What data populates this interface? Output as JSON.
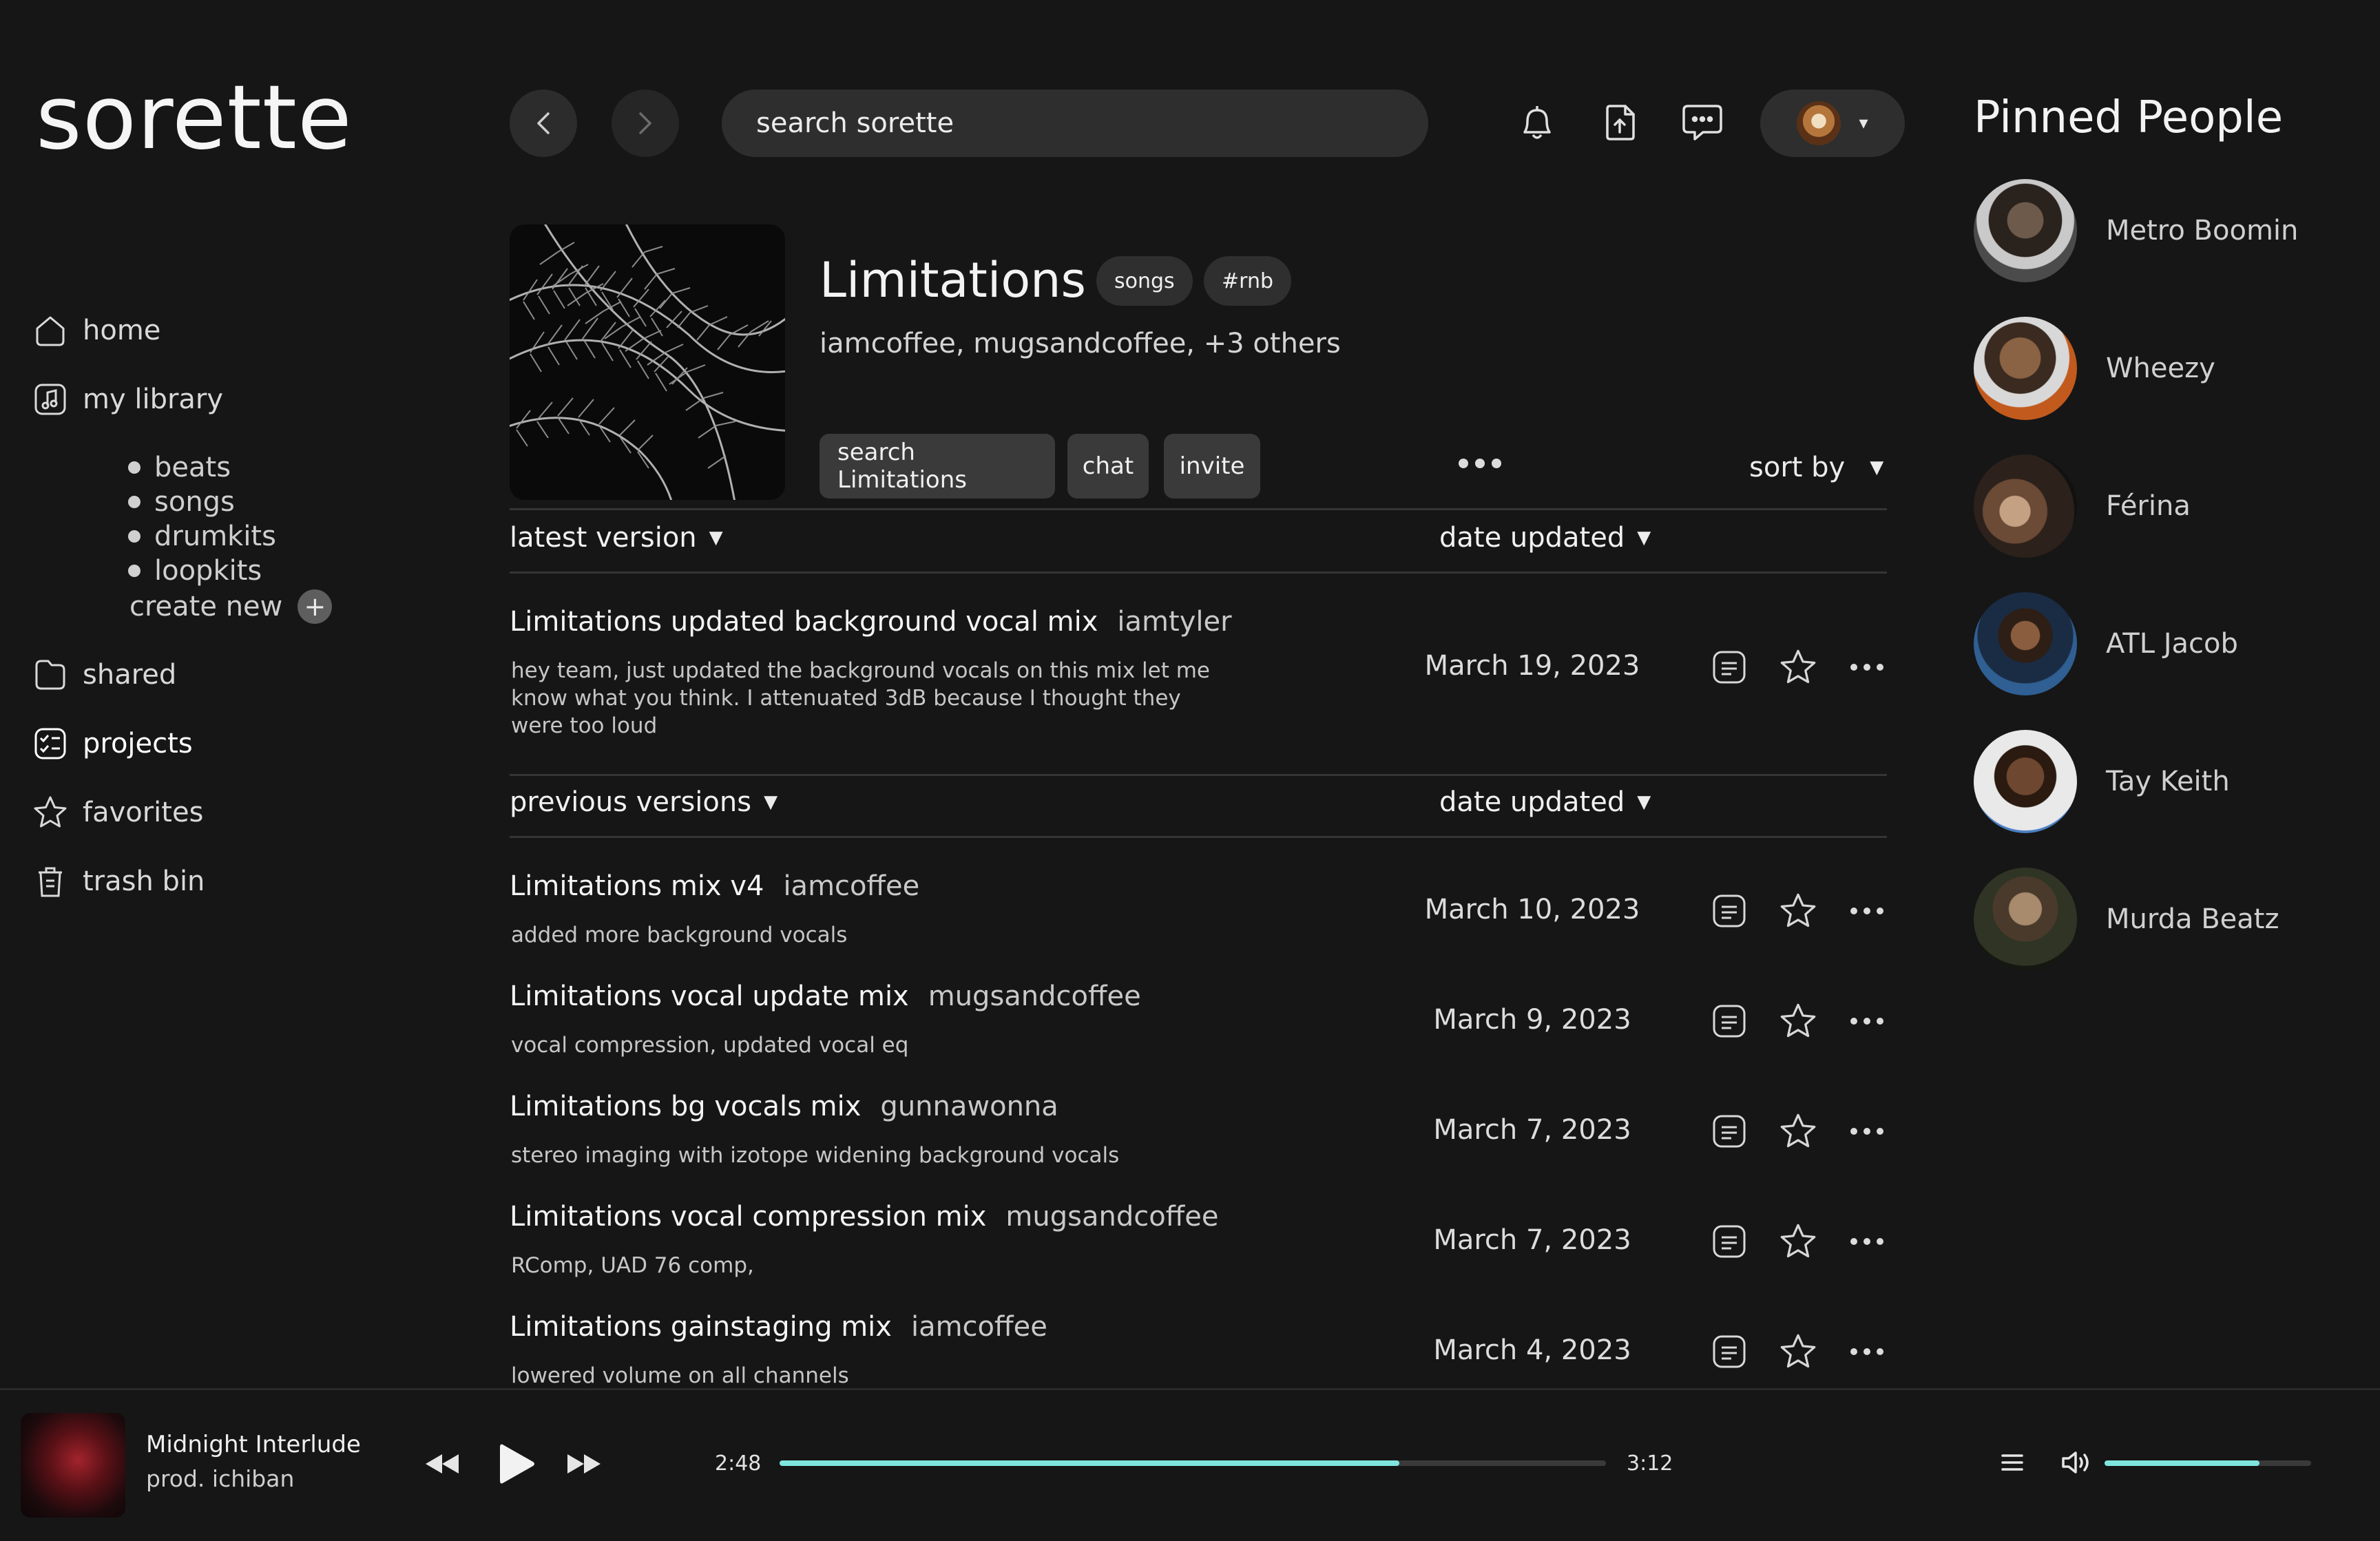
{
  "app": {
    "logo": "sorette"
  },
  "sidebar": {
    "items": [
      {
        "label": "home",
        "icon": "home-icon"
      },
      {
        "label": "my library",
        "icon": "music-note-icon"
      },
      {
        "label": "shared",
        "icon": "folder-icon"
      },
      {
        "label": "projects",
        "icon": "checklist-icon"
      },
      {
        "label": "favorites",
        "icon": "star-icon"
      },
      {
        "label": "trash bin",
        "icon": "trash-icon"
      }
    ],
    "library_sub": [
      "beats",
      "songs",
      "drumkits",
      "loopkits"
    ],
    "create_new": "create new",
    "plus_glyph": "+"
  },
  "topbar": {
    "search_placeholder": "search sorette",
    "icons": [
      "back-icon",
      "forward-icon",
      "bell-icon",
      "upload-icon",
      "message-icon",
      "avatar-dropdown"
    ],
    "dropdown_caret": "▾"
  },
  "project": {
    "title": "Limitations",
    "tags": [
      "songs",
      "#rnb"
    ],
    "people": "iamcoffee, mugsandcoffee, +3 others",
    "actions": [
      "search Limitations",
      "chat",
      "invite"
    ],
    "sort_label": "sort by",
    "caret": "▼"
  },
  "latest": {
    "header": "latest version",
    "date_header": "date updated",
    "row": {
      "title": "Limitations updated background vocal mix",
      "author": "iamtyler",
      "desc": "hey team, just updated the background vocals on this mix let me know what you think. I attenuated 3dB because I thought they were too loud",
      "date": "March 19, 2023"
    }
  },
  "previous": {
    "header": "previous versions",
    "date_header": "date updated",
    "rows": [
      {
        "title": "Limitations mix v4",
        "author": "iamcoffee",
        "desc": "added more background vocals",
        "date": "March 10, 2023"
      },
      {
        "title": "Limitations vocal update mix",
        "author": "mugsandcoffee",
        "desc": "vocal compression, updated vocal eq",
        "date": "March 9, 2023"
      },
      {
        "title": "Limitations bg vocals mix",
        "author": "gunnawonna",
        "desc": "stereo imaging with izotope widening background vocals",
        "date": "March 7, 2023"
      },
      {
        "title": "Limitations vocal compression mix",
        "author": "mugsandcoffee",
        "desc": "RComp, UAD 76 comp,",
        "date": "March 7, 2023"
      },
      {
        "title": "Limitations gainstaging mix",
        "author": "iamcoffee",
        "desc": "lowered volume on all channels",
        "date": "March 4, 2023"
      }
    ]
  },
  "pinned": {
    "title": "Pinned People",
    "people": [
      "Metro Boomin",
      "Wheezy",
      "Férina",
      "ATL Jacob",
      "Tay Keith",
      "Murda Beatz"
    ]
  },
  "player": {
    "track_title": "Midnight Interlude",
    "track_sub": "prod. ichiban",
    "elapsed": "2:48",
    "total": "3:12",
    "progress_fraction": 0.75,
    "volume_fraction": 0.75,
    "accent_color": "#7fe6df"
  },
  "colors": {
    "background": "#161616",
    "surface": "#2e2e2e",
    "accent": "#7fe6df"
  }
}
